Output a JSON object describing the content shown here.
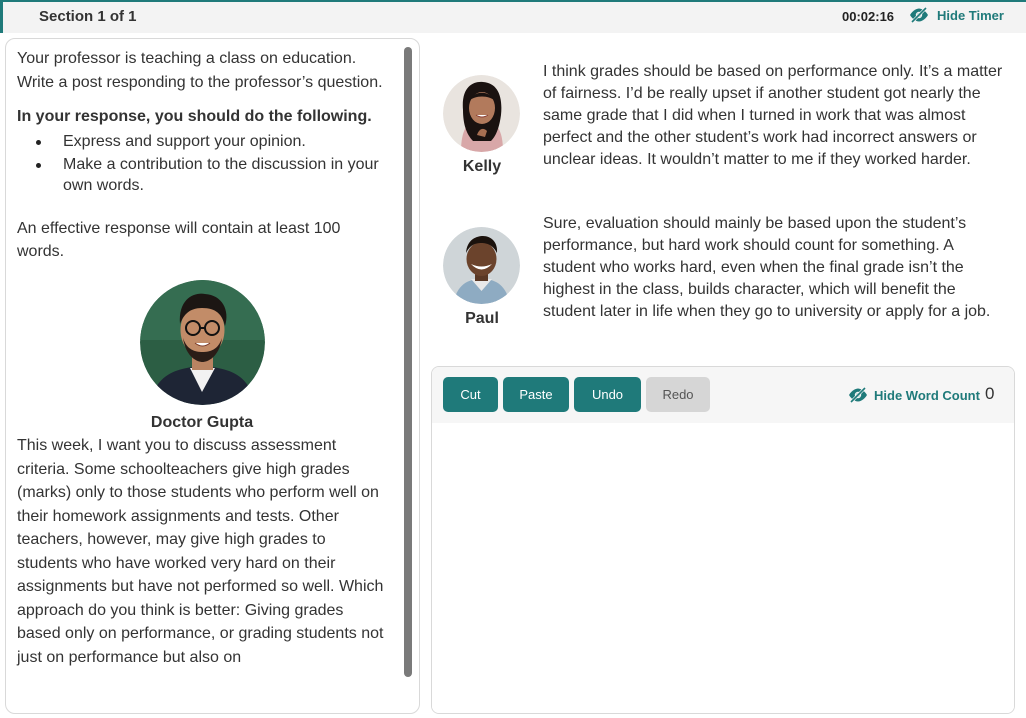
{
  "header": {
    "section": "Section 1 of 1",
    "timer": "00:02:16",
    "hide_timer_label": "Hide Timer",
    "eye_icon": "eye-slash-icon"
  },
  "prompt": {
    "intro": "Your professor is teaching a class on education. Write a post responding to the professor’s question.",
    "instruction_heading": "In your response, you should do the following.",
    "bullets": [
      "Express and support your opinion.",
      "Make a contribution to the discussion in your own words."
    ],
    "requirement": "An effective response will contain at least 100 words.",
    "professor_name": "Doctor Gupta",
    "professor_text": "This week, I want you to discuss assessment criteria. Some schoolteachers give high grades (marks) only to those students who perform well on their homework assignments and tests. Other teachers, however, may give high grades to students who have worked very hard on their assignments but have not performed so well. Which approach do you think is better: Giving grades based only on performance, or grading students not just on performance but also on"
  },
  "students": [
    {
      "name": "Kelly",
      "post": "I think grades should be based on performance only. It’s a matter of fairness. I’d be really upset if another student got nearly the same grade that I did when I turned in work that was almost perfect and the other student’s work had incorrect answers or unclear ideas. It wouldn’t matter to me if they worked harder."
    },
    {
      "name": "Paul",
      "post": "Sure, evaluation should mainly be based upon the student’s performance, but hard work should count for something. A student who works hard, even when the final grade isn’t the highest in the class, builds character, which will benefit the student later in life when they go to university or apply for a job."
    }
  ],
  "editor": {
    "cut_label": "Cut",
    "paste_label": "Paste",
    "undo_label": "Undo",
    "redo_label": "Redo",
    "hide_word_count_label": "Hide Word Count",
    "word_count": "0",
    "text": ""
  },
  "colors": {
    "accent": "#1f7a7a",
    "disabled_button": "#d6d6d6"
  }
}
